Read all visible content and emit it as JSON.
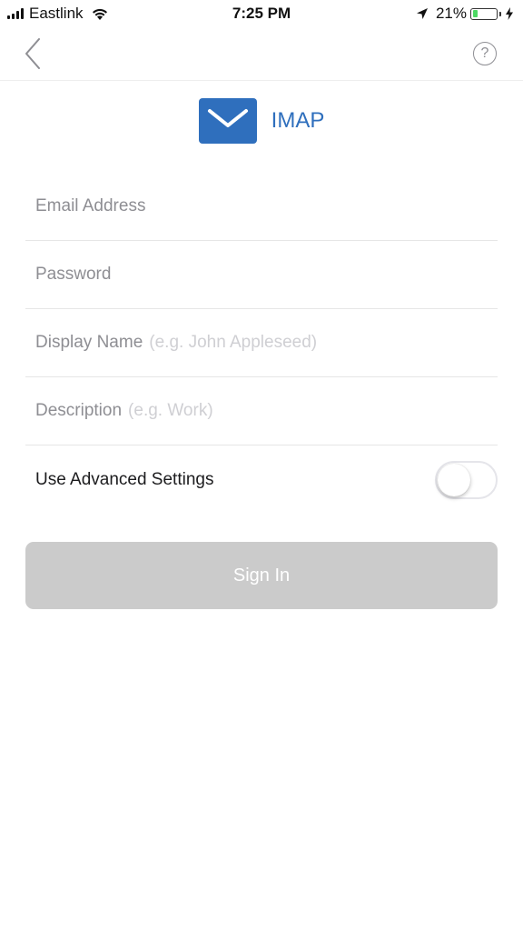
{
  "status_bar": {
    "carrier": "Eastlink",
    "time": "7:25 PM",
    "battery_percent": "21%",
    "battery_level": 0.21,
    "battery_color": "#4cd964"
  },
  "nav": {
    "back_icon": "chevron-left-icon",
    "help_label": "?"
  },
  "header": {
    "icon": "mail-envelope-icon",
    "title": "IMAP",
    "accent_color": "#2f6fbd"
  },
  "form": {
    "email": {
      "placeholder": "Email Address",
      "value": ""
    },
    "password": {
      "placeholder": "Password",
      "value": ""
    },
    "display_name": {
      "placeholder": "Display Name",
      "hint": "(e.g. John Appleseed)",
      "value": ""
    },
    "description": {
      "placeholder": "Description",
      "hint": "(e.g. Work)",
      "value": ""
    },
    "advanced": {
      "label": "Use Advanced Settings",
      "enabled": false
    }
  },
  "sign_in": {
    "label": "Sign In",
    "enabled": false
  }
}
